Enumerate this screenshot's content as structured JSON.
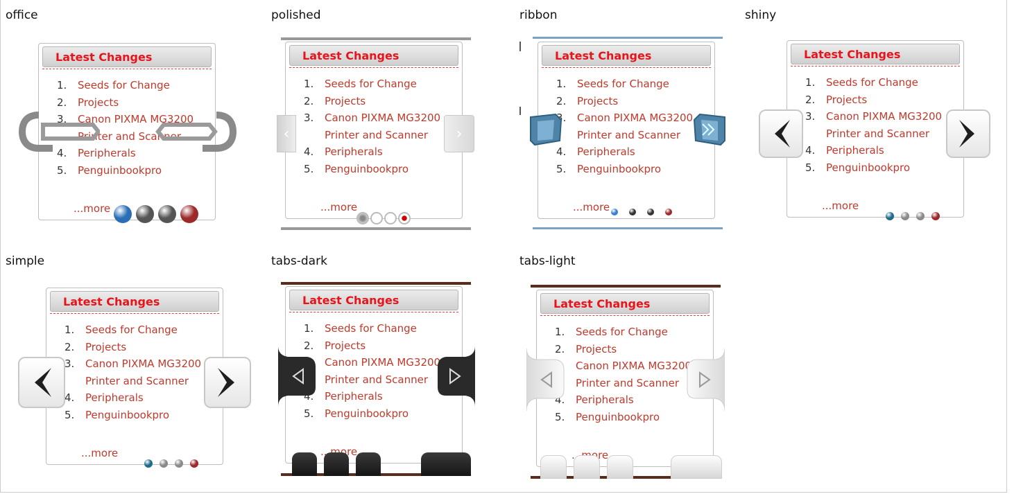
{
  "card": {
    "header": "Latest Changes",
    "items": [
      {
        "num": "1.",
        "text": "Seeds for Change"
      },
      {
        "num": "2.",
        "text": "Projects"
      },
      {
        "num": "3.",
        "text": "Canon PIXMA MG3200 Printer and Scanner"
      },
      {
        "num": "4.",
        "text": "Peripherals"
      },
      {
        "num": "5.",
        "text": "Penguinbookpro"
      }
    ],
    "more": "...more"
  },
  "styles": [
    {
      "name": "office"
    },
    {
      "name": "polished"
    },
    {
      "name": "ribbon"
    },
    {
      "name": "shiny"
    },
    {
      "name": "simple"
    },
    {
      "name": "tabs-dark"
    },
    {
      "name": "tabs-light"
    }
  ],
  "colors": {
    "link": "#c0392b",
    "header_text": "#e8141b",
    "blue_dot": "#2a6fb5",
    "red_dot": "#9c2a2a",
    "ribbon_bar": "#7aa3c4",
    "tabs_bar": "#5a2a1a"
  },
  "icons": {
    "prev": "chevron-left-icon",
    "next": "chevron-right-icon",
    "pager": "pagination-dot-icon"
  }
}
